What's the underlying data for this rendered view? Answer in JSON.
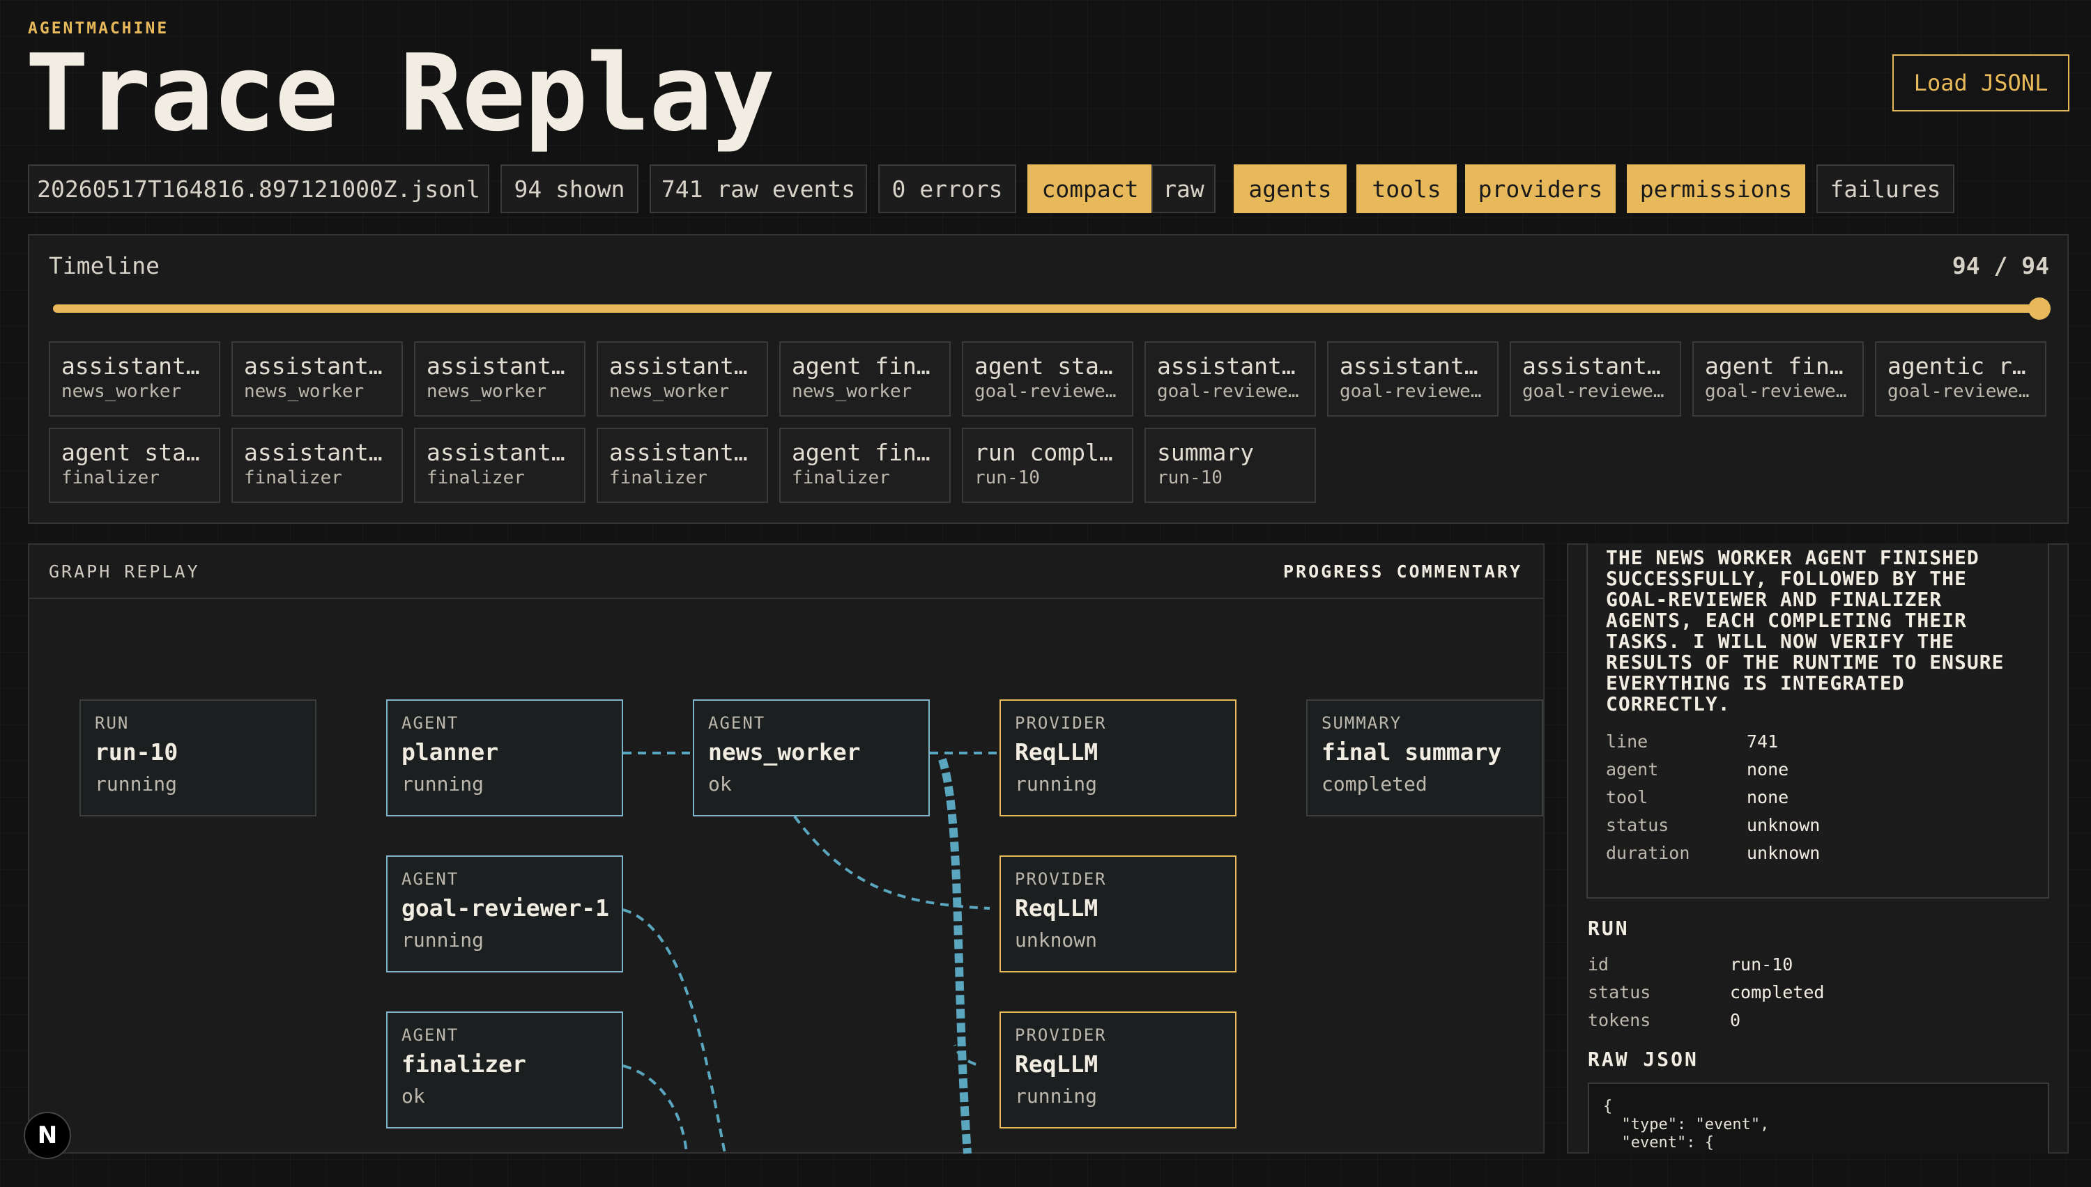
{
  "header": {
    "brand": "AGENTMACHINE",
    "title": "Trace Replay",
    "load_button": "Load JSONL"
  },
  "chips": [
    {
      "label": "20260517T164816.897121000Z.jsonl",
      "active": false
    },
    {
      "label": "94 shown",
      "active": false
    },
    {
      "label": "741 raw events",
      "active": false
    },
    {
      "label": "0 errors",
      "active": false
    },
    {
      "label": "compact",
      "active": true
    },
    {
      "label": "raw",
      "active": false
    },
    {
      "label": "agents",
      "active": true
    },
    {
      "label": "tools",
      "active": true
    },
    {
      "label": "providers",
      "active": true
    },
    {
      "label": "permissions",
      "active": true
    },
    {
      "label": "failures",
      "active": false
    }
  ],
  "timeline": {
    "label": "Timeline",
    "count": "94 / 94",
    "progress": 1.0,
    "events": [
      {
        "title": "assistant…",
        "sub": "news_worker"
      },
      {
        "title": "assistant…",
        "sub": "news_worker"
      },
      {
        "title": "assistant…",
        "sub": "news_worker"
      },
      {
        "title": "assistant…",
        "sub": "news_worker"
      },
      {
        "title": "agent fin…",
        "sub": "news_worker"
      },
      {
        "title": "agent sta…",
        "sub": "goal-reviewe…"
      },
      {
        "title": "assistant…",
        "sub": "goal-reviewe…"
      },
      {
        "title": "assistant…",
        "sub": "goal-reviewe…"
      },
      {
        "title": "assistant…",
        "sub": "goal-reviewe…"
      },
      {
        "title": "agent fin…",
        "sub": "goal-reviewe…"
      },
      {
        "title": "agentic r…",
        "sub": "goal-reviewe…"
      },
      {
        "title": "agent sta…",
        "sub": "finalizer"
      },
      {
        "title": "assistant…",
        "sub": "finalizer"
      },
      {
        "title": "assistant…",
        "sub": "finalizer"
      },
      {
        "title": "assistant…",
        "sub": "finalizer"
      },
      {
        "title": "agent fin…",
        "sub": "finalizer"
      },
      {
        "title": "run compl…",
        "sub": "run-10"
      },
      {
        "title": "summary",
        "sub": "run-10"
      }
    ]
  },
  "graph": {
    "label": "GRAPH REPLAY",
    "commentary_label": "PROGRESS COMMENTARY",
    "nodes": [
      {
        "kind": "RUN",
        "name": "run-10",
        "status": "running"
      },
      {
        "kind": "AGENT",
        "name": "planner",
        "status": "running"
      },
      {
        "kind": "AGENT",
        "name": "news_worker",
        "status": "ok"
      },
      {
        "kind": "PROVIDER",
        "name": "ReqLLM",
        "status": "running"
      },
      {
        "kind": "SUMMARY",
        "name": "final summary",
        "status": "completed"
      },
      {
        "kind": "AGENT",
        "name": "goal-reviewer-1",
        "status": "running"
      },
      {
        "kind": "PROVIDER",
        "name": "ReqLLM",
        "status": "unknown"
      },
      {
        "kind": "AGENT",
        "name": "finalizer",
        "status": "ok"
      },
      {
        "kind": "PROVIDER",
        "name": "ReqLLM",
        "status": "running"
      }
    ]
  },
  "detail": {
    "message": "THE NEWS WORKER AGENT FINISHED SUCCESSFULLY, FOLLOWED BY THE GOAL-REVIEWER AND FINALIZER AGENTS, EACH COMPLETING THEIR TASKS. I WILL NOW VERIFY THE RESULTS OF THE RUNTIME TO ENSURE EVERYTHING IS INTEGRATED CORRECTLY.",
    "fields": [
      {
        "k": "line",
        "v": "741"
      },
      {
        "k": "agent",
        "v": "none"
      },
      {
        "k": "tool",
        "v": "none"
      },
      {
        "k": "status",
        "v": "unknown"
      },
      {
        "k": "duration",
        "v": "unknown"
      }
    ],
    "run_title": "RUN",
    "run_fields": [
      {
        "k": "id",
        "v": "run-10"
      },
      {
        "k": "status",
        "v": "completed"
      },
      {
        "k": "tokens",
        "v": "0"
      }
    ],
    "raw_title": "RAW JSON",
    "raw_json": "{\n  \"type\": \"event\",\n  \"event\": {"
  },
  "footer": {
    "logo": "N"
  },
  "colors": {
    "accent": "#e8b95a",
    "agent": "#7fb7c9",
    "edge": "#5aa6bf",
    "background": "#121212"
  }
}
